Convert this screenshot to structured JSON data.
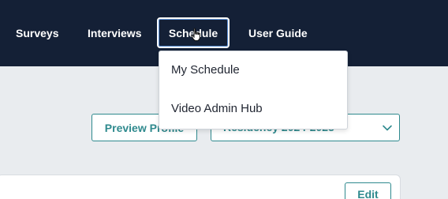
{
  "nav": {
    "items": [
      {
        "label": "Surveys"
      },
      {
        "label": "Interviews"
      },
      {
        "label": "Schedule",
        "active": true
      },
      {
        "label": "User Guide"
      }
    ]
  },
  "dropdown": {
    "items": [
      {
        "label": "My Schedule"
      },
      {
        "label": "Video Admin Hub"
      }
    ]
  },
  "toolbar": {
    "preview_label": "Preview Profile",
    "residency_selected": "Residency 2024-2025"
  },
  "card": {
    "edit_label": "Edit"
  },
  "colors": {
    "navbar_bg": "#142036",
    "page_bg": "#e9ecef",
    "accent": "#2f8a8e",
    "focus_ring": "#ffffff"
  },
  "icons": {
    "cursor": "hand-pointer-icon",
    "select_chevron": "chevron-down-icon"
  }
}
